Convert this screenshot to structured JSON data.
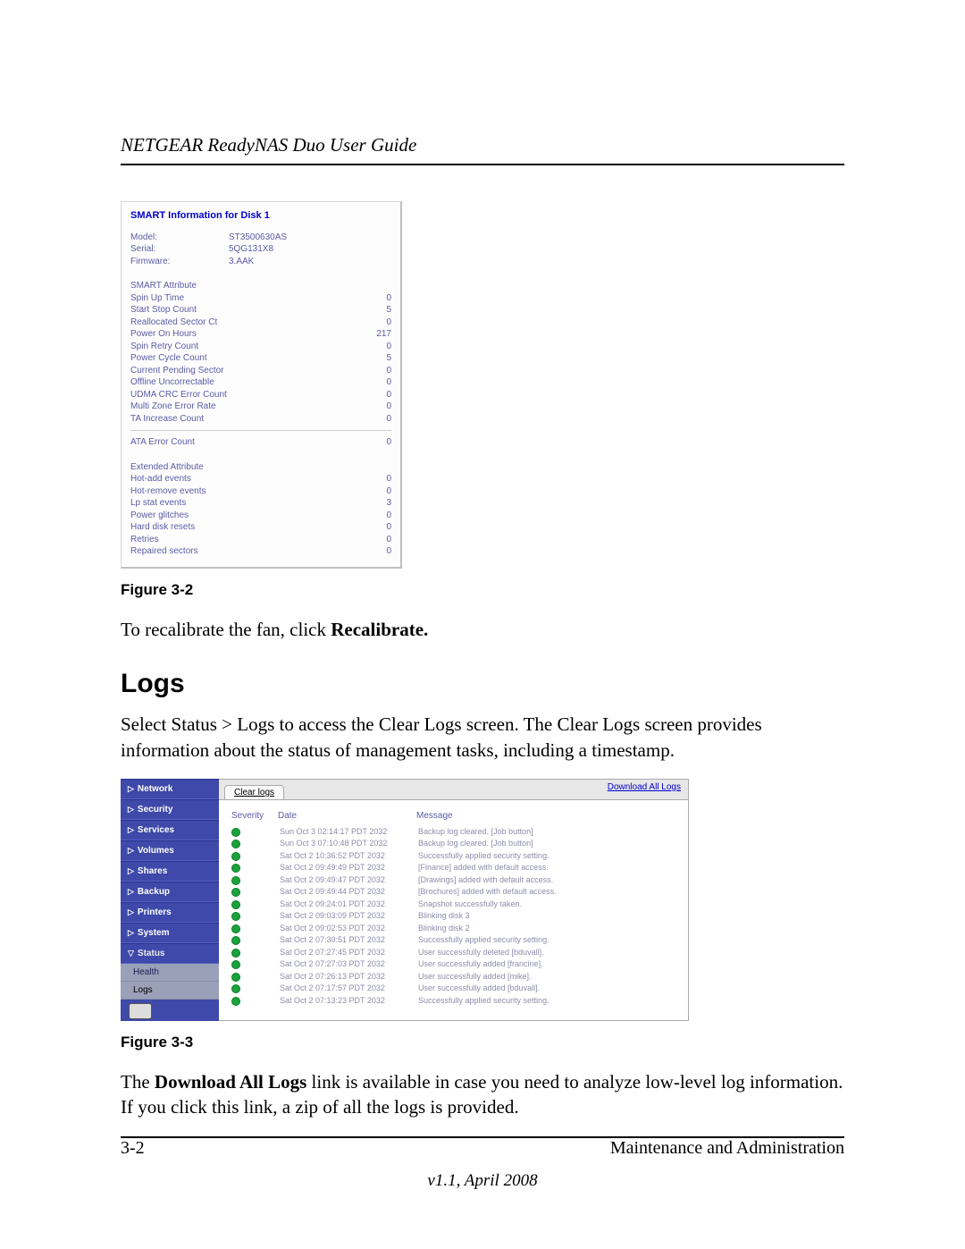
{
  "header": {
    "title": "NETGEAR ReadyNAS Duo User Guide"
  },
  "footer": {
    "page": "3-2",
    "section": "Maintenance and Administration",
    "version": "v1.1, April 2008"
  },
  "figure32": {
    "caption": "Figure 3-2",
    "title": "SMART Information for Disk 1",
    "ident": {
      "model_k": "Model:",
      "model_v": "ST3500630AS",
      "serial_k": "Serial:",
      "serial_v": "5QG131X8",
      "fw_k": "Firmware:",
      "fw_v": "3.AAK"
    },
    "smart_head": "SMART Attribute",
    "smart": [
      {
        "k": "Spin Up Time",
        "v": "0"
      },
      {
        "k": "Start Stop Count",
        "v": "5"
      },
      {
        "k": "Reallocated Sector Ct",
        "v": "0"
      },
      {
        "k": "Power On Hours",
        "v": "217"
      },
      {
        "k": "Spin Retry Count",
        "v": "0"
      },
      {
        "k": "Power Cycle Count",
        "v": "5"
      },
      {
        "k": "Current Pending Sector",
        "v": "0"
      },
      {
        "k": "Offline Uncorrectable",
        "v": "0"
      },
      {
        "k": "UDMA CRC Error Count",
        "v": "0"
      },
      {
        "k": "Multi Zone Error Rate",
        "v": "0"
      },
      {
        "k": "TA Increase Count",
        "v": "0"
      }
    ],
    "ata_k": "ATA Error Count",
    "ata_v": "0",
    "ext_head": "Extended Attribute",
    "ext": [
      {
        "k": "Hot-add events",
        "v": "0"
      },
      {
        "k": "Hot-remove events",
        "v": "0"
      },
      {
        "k": "Lp stat events",
        "v": "3"
      },
      {
        "k": "Power glitches",
        "v": "0"
      },
      {
        "k": "Hard disk resets",
        "v": "0"
      },
      {
        "k": "Retries",
        "v": "0"
      },
      {
        "k": "Repaired sectors",
        "v": "0"
      }
    ]
  },
  "body": {
    "recal_pre": "To recalibrate the fan, click ",
    "recal_bold": "Recalibrate.",
    "logs_h": "Logs",
    "logs_p": "Select Status > Logs to access the Clear Logs screen. The Clear Logs screen provides information about the status of management tasks, including a timestamp.",
    "after_pre": "The ",
    "after_bold": "Download All Logs",
    "after_post": " link is available in case you need to analyze low-level log information. If you click this link, a zip of all the logs is provided."
  },
  "figure33": {
    "caption": "Figure 3-3",
    "sidebar": [
      "Network",
      "Security",
      "Services",
      "Volumes",
      "Shares",
      "Backup",
      "Printers",
      "System",
      "Status"
    ],
    "sub": {
      "health": "Health",
      "logs": "Logs"
    },
    "tab": "Clear logs",
    "download": "Download All Logs",
    "cols": {
      "sev": "Severity",
      "date": "Date",
      "msg": "Message"
    },
    "rows": [
      {
        "d": "Sun Oct 3 02:14:17 PDT 2032",
        "m": "Backup log cleared. [Job button]"
      },
      {
        "d": "Sun Oct 3 07:10:48 PDT 2032",
        "m": "Backup log cleared. [Job button]"
      },
      {
        "d": "Sat Oct 2 10:36:52 PDT 2032",
        "m": "Successfully applied security setting."
      },
      {
        "d": "Sat Oct 2 09:49:49 PDT 2032",
        "m": "[Finance] added with default access."
      },
      {
        "d": "Sat Oct 2 09:49:47 PDT 2032",
        "m": "[Drawings] added with default access."
      },
      {
        "d": "Sat Oct 2 09:49:44 PDT 2032",
        "m": "[Brochures] added with default access."
      },
      {
        "d": "Sat Oct 2 09:24:01 PDT 2032",
        "m": "Snapshot successfully taken."
      },
      {
        "d": "Sat Oct 2 09:03:09 PDT 2032",
        "m": "Blinking disk 3"
      },
      {
        "d": "Sat Oct 2 09:02:53 PDT 2032",
        "m": "Blinking disk 2"
      },
      {
        "d": "Sat Oct 2 07:30:51 PDT 2032",
        "m": "Successfully applied security setting."
      },
      {
        "d": "Sat Oct 2 07:27:45 PDT 2032",
        "m": "User successfully deleted [bduvall]."
      },
      {
        "d": "Sat Oct 2 07:27:03 PDT 2032",
        "m": "User successfully added [francine]."
      },
      {
        "d": "Sat Oct 2 07:26:13 PDT 2032",
        "m": "User successfully added [mike]."
      },
      {
        "d": "Sat Oct 2 07:17:57 PDT 2032",
        "m": "User successfully added [bduvall]."
      },
      {
        "d": "Sat Oct 2 07:13:23 PDT 2032",
        "m": "Successfully applied security setting."
      }
    ]
  }
}
